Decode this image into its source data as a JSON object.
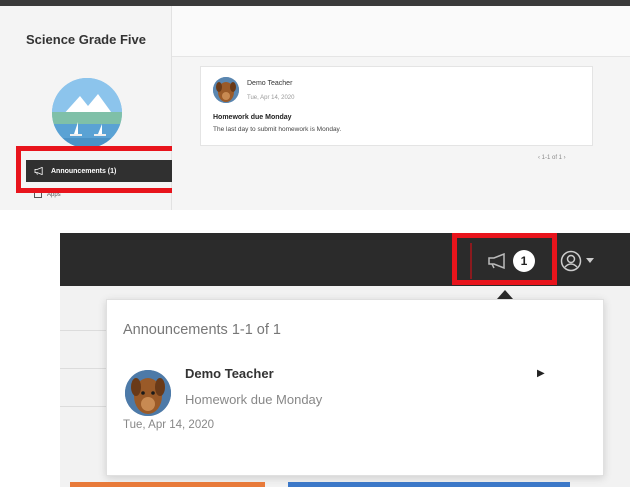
{
  "course": {
    "title": "Science Grade Five"
  },
  "sidebar": {
    "announcements_label": "Announcements (1)",
    "apps_label": "Apps"
  },
  "post": {
    "author": "Demo Teacher",
    "date": "Tue, Apr 14, 2020",
    "title": "Homework due Monday",
    "body": "The last day to submit homework is Monday."
  },
  "pagination": {
    "text": "‹ 1-1 of 1 ›"
  },
  "header": {
    "notification_count": "1",
    "megaphone_icon": "megaphone-icon",
    "user_icon": "user-circle-icon"
  },
  "dropdown": {
    "header": "Announcements 1-1 of 1",
    "author": "Demo Teacher",
    "title": "Homework due Monday",
    "date": "Tue, Apr 14, 2020"
  },
  "colors": {
    "highlight": "#e8141c",
    "dark_header": "#2b2b2b"
  }
}
